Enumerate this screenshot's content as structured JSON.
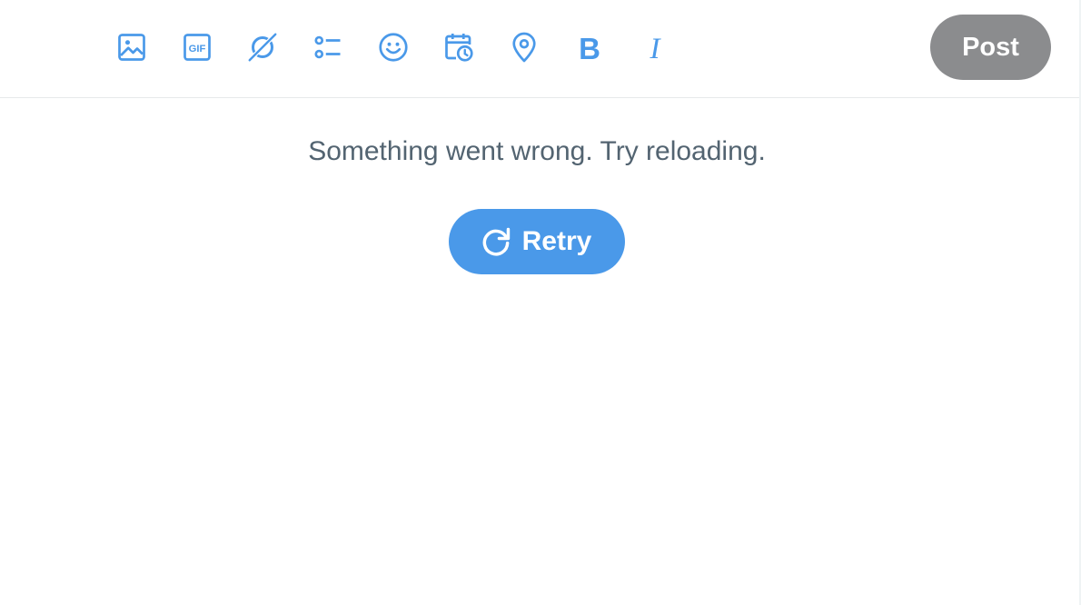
{
  "toolbar": {
    "icons": [
      {
        "name": "media-icon"
      },
      {
        "name": "gif-icon",
        "text": "GIF"
      },
      {
        "name": "grok-icon"
      },
      {
        "name": "poll-icon"
      },
      {
        "name": "emoji-icon"
      },
      {
        "name": "schedule-icon"
      },
      {
        "name": "location-icon"
      },
      {
        "name": "bold-icon",
        "text": "B"
      },
      {
        "name": "italic-icon",
        "text": "I"
      }
    ],
    "post_label": "Post"
  },
  "error": {
    "message": "Something went wrong. Try reloading.",
    "retry_label": "Retry"
  },
  "colors": {
    "accent": "#4a99e9",
    "post_disabled": "#8b8c8e",
    "text_secondary": "#536471"
  }
}
